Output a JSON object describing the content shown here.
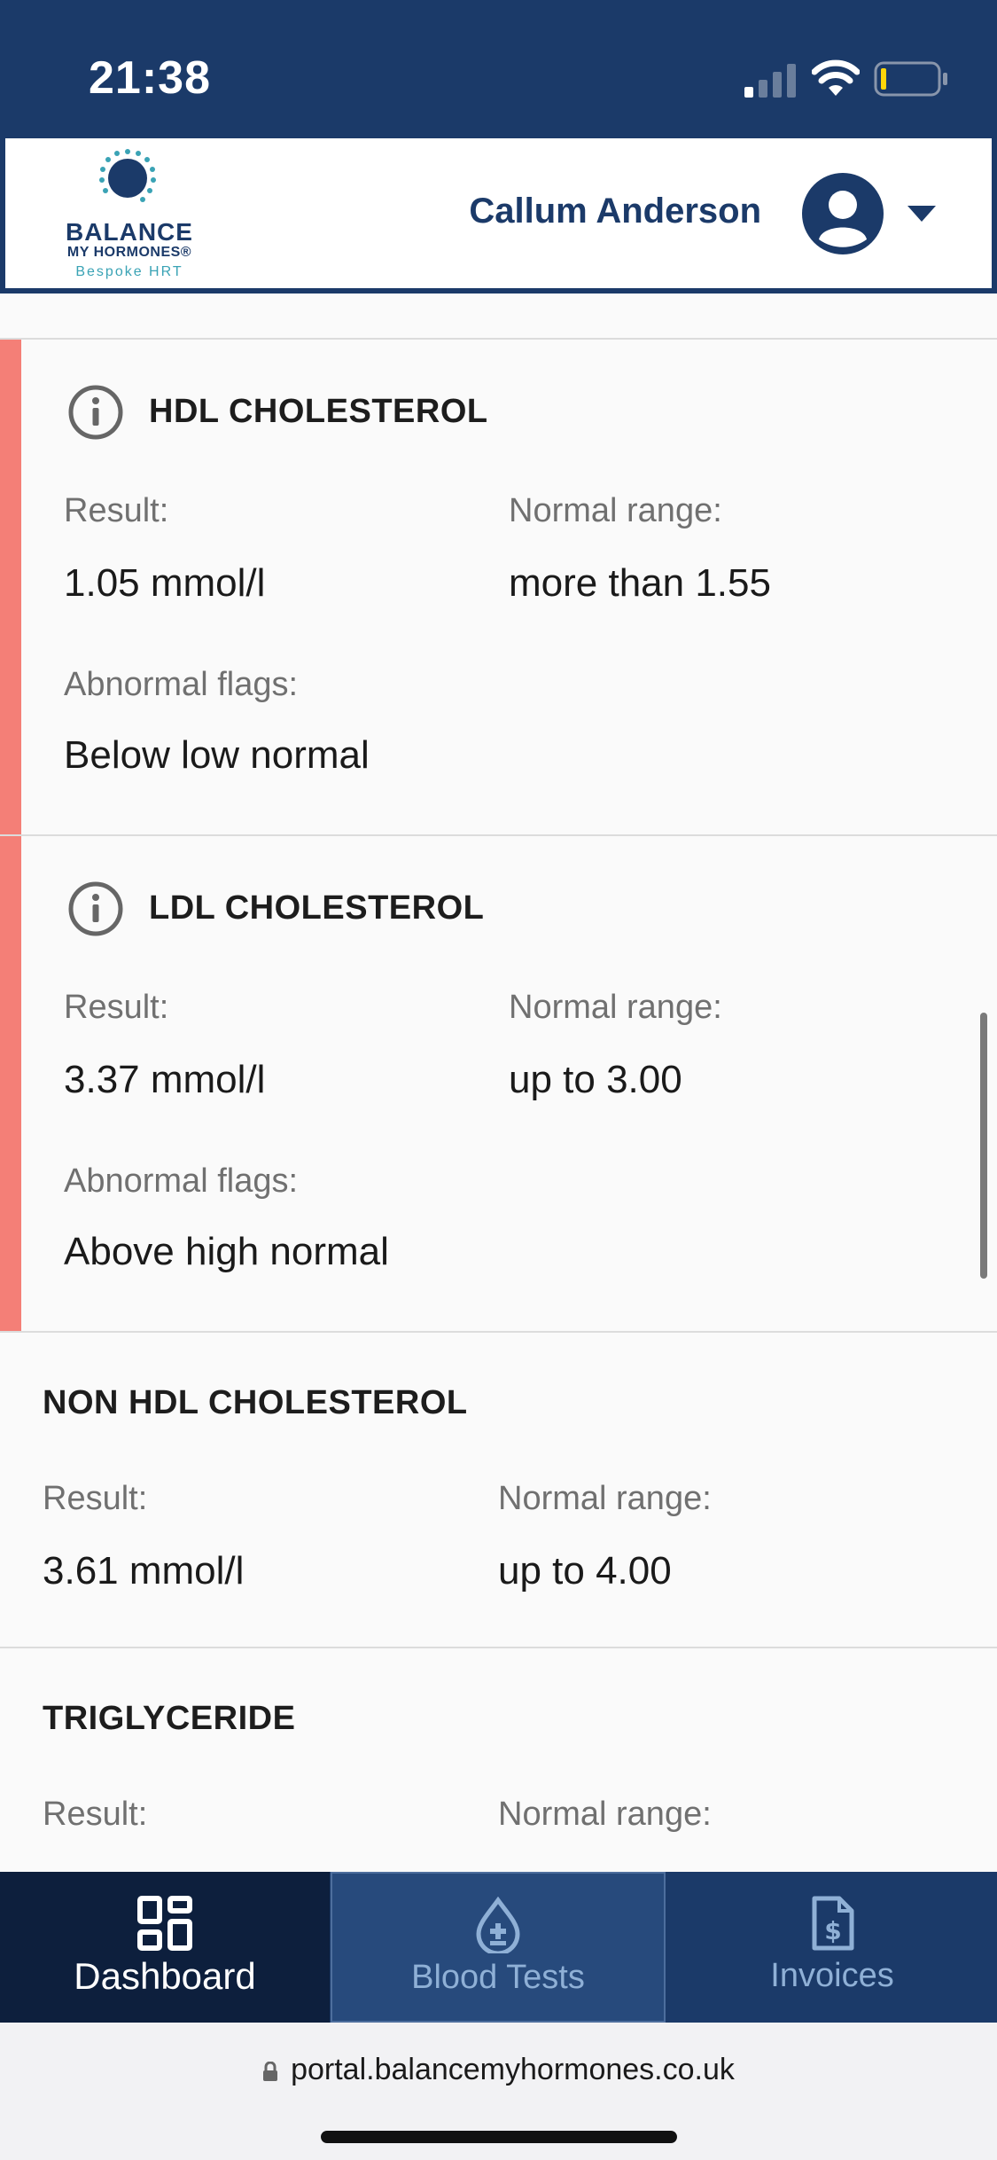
{
  "status_bar": {
    "time": "21:38"
  },
  "header": {
    "logo": {
      "line1": "BALANCE",
      "line2": "MY HORMONES®",
      "line3": "Bespoke HRT"
    },
    "user_name": "Callum Anderson",
    "icons": {
      "avatar": "user-circle-icon",
      "menu": "caret-down-icon"
    }
  },
  "results": [
    {
      "name": "HDL CHOLESTEROL",
      "abnormal": true,
      "result_label": "Result:",
      "result": "1.05 mmol/l",
      "range_label": "Normal range:",
      "range": "more than 1.55",
      "flags_label": "Abnormal flags:",
      "flags": "Below low normal"
    },
    {
      "name": "LDL CHOLESTEROL",
      "abnormal": true,
      "result_label": "Result:",
      "result": "3.37 mmol/l",
      "range_label": "Normal range:",
      "range": "up to 3.00",
      "flags_label": "Abnormal flags:",
      "flags": "Above high normal"
    },
    {
      "name": "NON HDL CHOLESTEROL",
      "abnormal": false,
      "result_label": "Result:",
      "result": "3.61 mmol/l",
      "range_label": "Normal range:",
      "range": "up to 4.00"
    },
    {
      "name": "TRIGLYCERIDE",
      "abnormal": false,
      "result_label": "Result:",
      "range_label": "Normal range:"
    }
  ],
  "bottom_nav": {
    "items": [
      {
        "label": "Dashboard",
        "icon": "dashboard-icon",
        "active": true
      },
      {
        "label": "Blood Tests",
        "icon": "blood-drop-icon",
        "active": false
      },
      {
        "label": "Invoices",
        "icon": "invoice-icon",
        "active": false
      }
    ]
  },
  "browser": {
    "url": "portal.balancemyhormones.co.uk"
  },
  "colors": {
    "brand": "#1b3a69",
    "abnormal": "#f47f77",
    "accent": "#3aa3b5"
  }
}
